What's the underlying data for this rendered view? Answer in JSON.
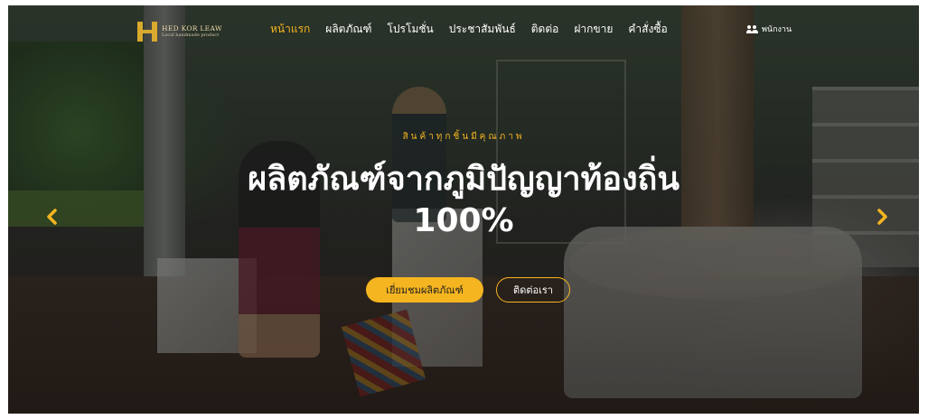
{
  "brand": {
    "name": "HED KOR LEAW",
    "tagline": "Local handmade product"
  },
  "nav": {
    "items": [
      {
        "label": "หน้าแรก",
        "active": true
      },
      {
        "label": "ผลิตภัณฑ์",
        "active": false
      },
      {
        "label": "โปรโมชั่น",
        "active": false
      },
      {
        "label": "ประชาสัมพันธ์",
        "active": false
      },
      {
        "label": "ติดต่อ",
        "active": false
      },
      {
        "label": "ฝากขาย",
        "active": false
      },
      {
        "label": "คำสั่งซื้อ",
        "active": false
      }
    ],
    "staff_label": "พนักงาน"
  },
  "hero": {
    "subtitle": "สินค้าทุกชิ้นมีคุณภาพ",
    "title_line1": "ผลิตภัณฑ์จากภูมิปัญญาท้องถิ่น",
    "title_line2": "100%",
    "primary_button": "เยี่ยมชมผลิตภัณฑ์",
    "secondary_button": "ติดต่อเรา"
  },
  "colors": {
    "accent": "#f5b520",
    "text": "#ffffff"
  },
  "icons": {
    "staff": "users-icon",
    "prev": "chevron-left-icon",
    "next": "chevron-right-icon"
  }
}
